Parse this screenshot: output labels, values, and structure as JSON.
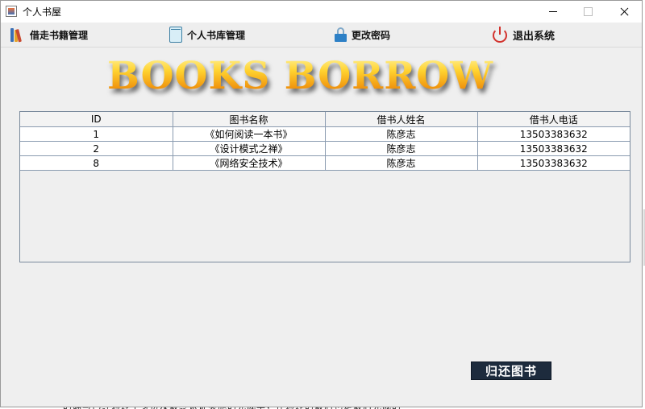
{
  "window": {
    "title": "个人书屋"
  },
  "menu": {
    "items": [
      {
        "label": "借走书籍管理",
        "icon": "books-icon"
      },
      {
        "label": "个人书库管理",
        "icon": "book-icon"
      },
      {
        "label": "更改密码",
        "icon": "lock-icon"
      },
      {
        "label": "退出系统",
        "icon": "power-icon"
      }
    ]
  },
  "banner": {
    "text": "BOOKS BORROW"
  },
  "table": {
    "columns": [
      "ID",
      "图书名称",
      "借书人姓名",
      "借书人电话"
    ],
    "rows": [
      [
        "1",
        "《如何阅读一本书》",
        "陈彦志",
        "13503383632"
      ],
      [
        "2",
        "《设计模式之禅》",
        "陈彦志",
        "13503383632"
      ],
      [
        "8",
        "《网络安全技术》",
        "陈彦志",
        "13503383632"
      ]
    ]
  },
  "actions": {
    "return_label": "归还图书"
  },
  "background": {
    "text": "的确与已经通过了身份及最终认证实施的完成率，在通过的最后也是最后完成的"
  },
  "colors": {
    "return_button_bg": "#1d2b3d",
    "banner_gold": "#f1a90d",
    "power_red": "#d2322d"
  }
}
